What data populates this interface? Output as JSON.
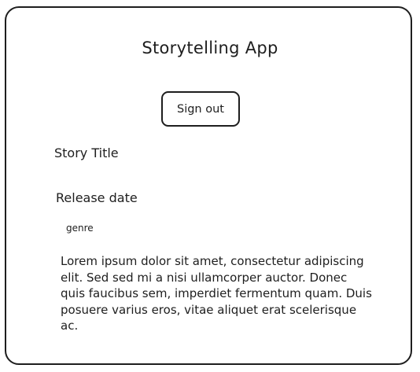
{
  "app": {
    "title": "Storytelling App"
  },
  "header": {
    "sign_out_label": "Sign out"
  },
  "story": {
    "title": "Story Title",
    "release_date": "Release date",
    "genre": "genre",
    "description": "Lorem ipsum dolor sit amet, consectetur adipiscing elit. Sed sed mi a nisi ullamcorper auctor. Donec quis faucibus sem, imperdiet fermentum quam. Duis posuere varius eros, vitae aliquet erat scelerisque ac."
  }
}
